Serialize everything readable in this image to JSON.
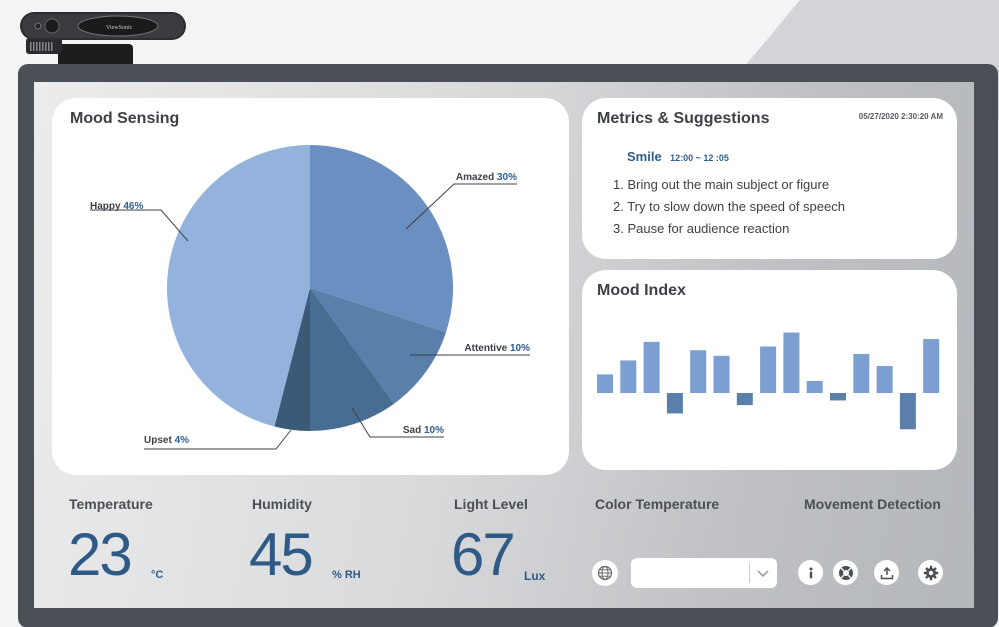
{
  "mood_sensing": {
    "title": "Mood Sensing"
  },
  "metrics": {
    "title": "Metrics & Suggestions",
    "timestamp": "05/27/2020  2:30:20 AM",
    "smile_label": "Smile",
    "smile_time": "12:00 ~ 12 :05",
    "suggestions": [
      "1.  Bring out the main subject or figure",
      "2.  Try to slow down the speed of speech",
      "3.   Pause for audience reaction"
    ]
  },
  "mood_index": {
    "title": "Mood Index"
  },
  "sensors": {
    "temperature": {
      "label": "Temperature",
      "value": "23",
      "unit": "°C"
    },
    "humidity": {
      "label": "Humidity",
      "value": "45",
      "unit": "% RH"
    },
    "light": {
      "label": "Light Level",
      "value": "67",
      "unit": "Lux"
    },
    "color_temperature": {
      "label": "Color Temperature"
    },
    "movement": {
      "label": "Movement Detection"
    }
  },
  "controls": {
    "select_value": "",
    "icons": [
      "globe-icon",
      "chevron-down-icon",
      "info-icon",
      "lifebuoy-icon",
      "upload-icon",
      "gear-icon"
    ]
  },
  "chart_data": [
    {
      "type": "pie",
      "title": "Mood Sensing",
      "categories": [
        "Amazed",
        "Attentive",
        "Sad",
        "Upset",
        "Happy"
      ],
      "values": [
        30,
        10,
        10,
        4,
        46
      ],
      "labels": [
        "30%",
        "10%",
        "10%",
        "4%",
        "46%"
      ],
      "colors": [
        "#6a8fc0",
        "#5a7fab",
        "#476d92",
        "#3b5a78",
        "#93b3dc"
      ]
    },
    {
      "type": "bar",
      "title": "Mood Index",
      "values": [
        2,
        3.5,
        5.5,
        -2.2,
        4.6,
        4,
        -1.3,
        5,
        6.5,
        1.3,
        -0.8,
        4.2,
        2.9,
        -3.9,
        5.8
      ]
    }
  ],
  "colors": {
    "accent": "#2f5a86",
    "monitor": "#4b5057"
  }
}
